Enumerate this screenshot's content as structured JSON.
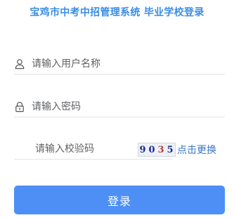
{
  "header": {
    "title": "宝鸡市中考中招管理系统 毕业学校登录"
  },
  "form": {
    "username": {
      "placeholder": "请输入用户名称",
      "icon": "user-icon"
    },
    "password": {
      "placeholder": "请输入密码",
      "icon": "lock-icon"
    },
    "captcha": {
      "placeholder": "请输入校验码",
      "digits": [
        "9",
        "0",
        "3",
        "5"
      ],
      "refresh_label": "点击更换"
    },
    "submit_label": "登录"
  },
  "colors": {
    "title": "#3a8ee6",
    "button": "#4d8ff5",
    "link": "#3a76c4",
    "captcha_red": "#c0392b",
    "captcha_blue": "#1a2b8c"
  }
}
